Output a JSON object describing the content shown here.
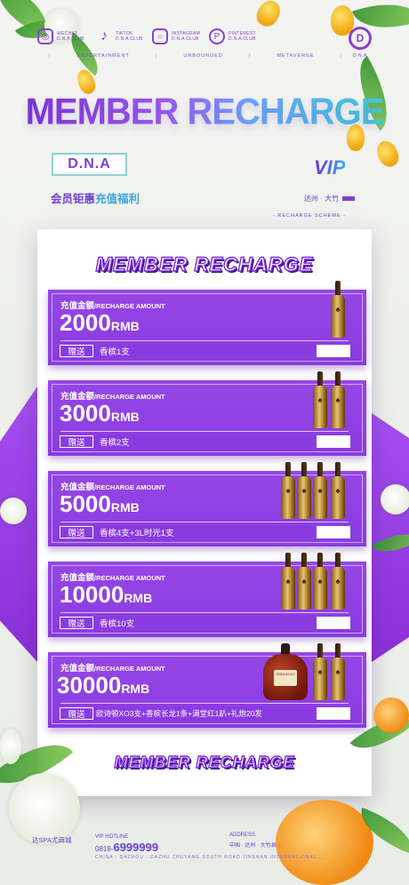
{
  "social": [
    {
      "icon": "wechat-icon",
      "line1": "WECHAT",
      "line2": "D.N.A CLUB"
    },
    {
      "icon": "tiktok-icon",
      "line1": "TIKTOK",
      "line2": "D.N.A CLUB"
    },
    {
      "icon": "instagram-icon",
      "line1": "INSTAGRAM",
      "line2": "D.N.A CLUB"
    },
    {
      "icon": "pinterest-icon",
      "line1": "PINTEREST",
      "line2": "D.N.A CLUB"
    }
  ],
  "nav": [
    "ENTERTAINMENT",
    "UNBOUNDED",
    "METAVERSE"
  ],
  "brand_small": "D.N.A",
  "headline": "MEMBER RECHARGE",
  "dna_logo": "D.N.A",
  "vip": "VIP",
  "benefit_a": "会员钜惠",
  "benefit_b": "充值福利",
  "city": "达州 · 大竹",
  "scheme": "- RECHARGE SCHEME -",
  "card_title": "MEMBER RECHARGE",
  "card_title_bottom": "MEMBER RECHARGE",
  "amount_label_cn": "充值金额",
  "amount_label_en": "/RECHARGE AMOUNT",
  "gift_tag": "赠送",
  "items": [
    {
      "amount": "2000",
      "unit": "RMB",
      "gift": "香槟1支",
      "bottles": 1
    },
    {
      "amount": "3000",
      "unit": "RMB",
      "gift": "香槟2支",
      "bottles": 2
    },
    {
      "amount": "5000",
      "unit": "RMB",
      "gift": "香槟4支+3L时光1支",
      "bottles": 4
    },
    {
      "amount": "10000",
      "unit": "RMB",
      "gift": "香槟10支",
      "bottles": 4
    },
    {
      "amount": "30000",
      "unit": "RMB",
      "gift": "欧诗顿XO3支+香槟长龙1条+满堂红1趴+礼炮20发",
      "bottles": 2,
      "cognac": true
    }
  ],
  "cognac_label": "OSDUN XO",
  "footer": {
    "left_title": "达SPA尤商城",
    "left_sub": "",
    "hotline_label": "VIP HOTLINE",
    "phone_code": "0818-",
    "phone": "6999999",
    "address_label": "ADDRESS",
    "address": "中国 · 达州 · 大竹县 ...",
    "english": "CHINA · DAZHOU · DAZHU ZHUYANG SOUTH ROAD JINSHAN INTERNATIONAL ..."
  },
  "colors": {
    "accent": "#8a3be0",
    "teal": "#33d6d0"
  }
}
